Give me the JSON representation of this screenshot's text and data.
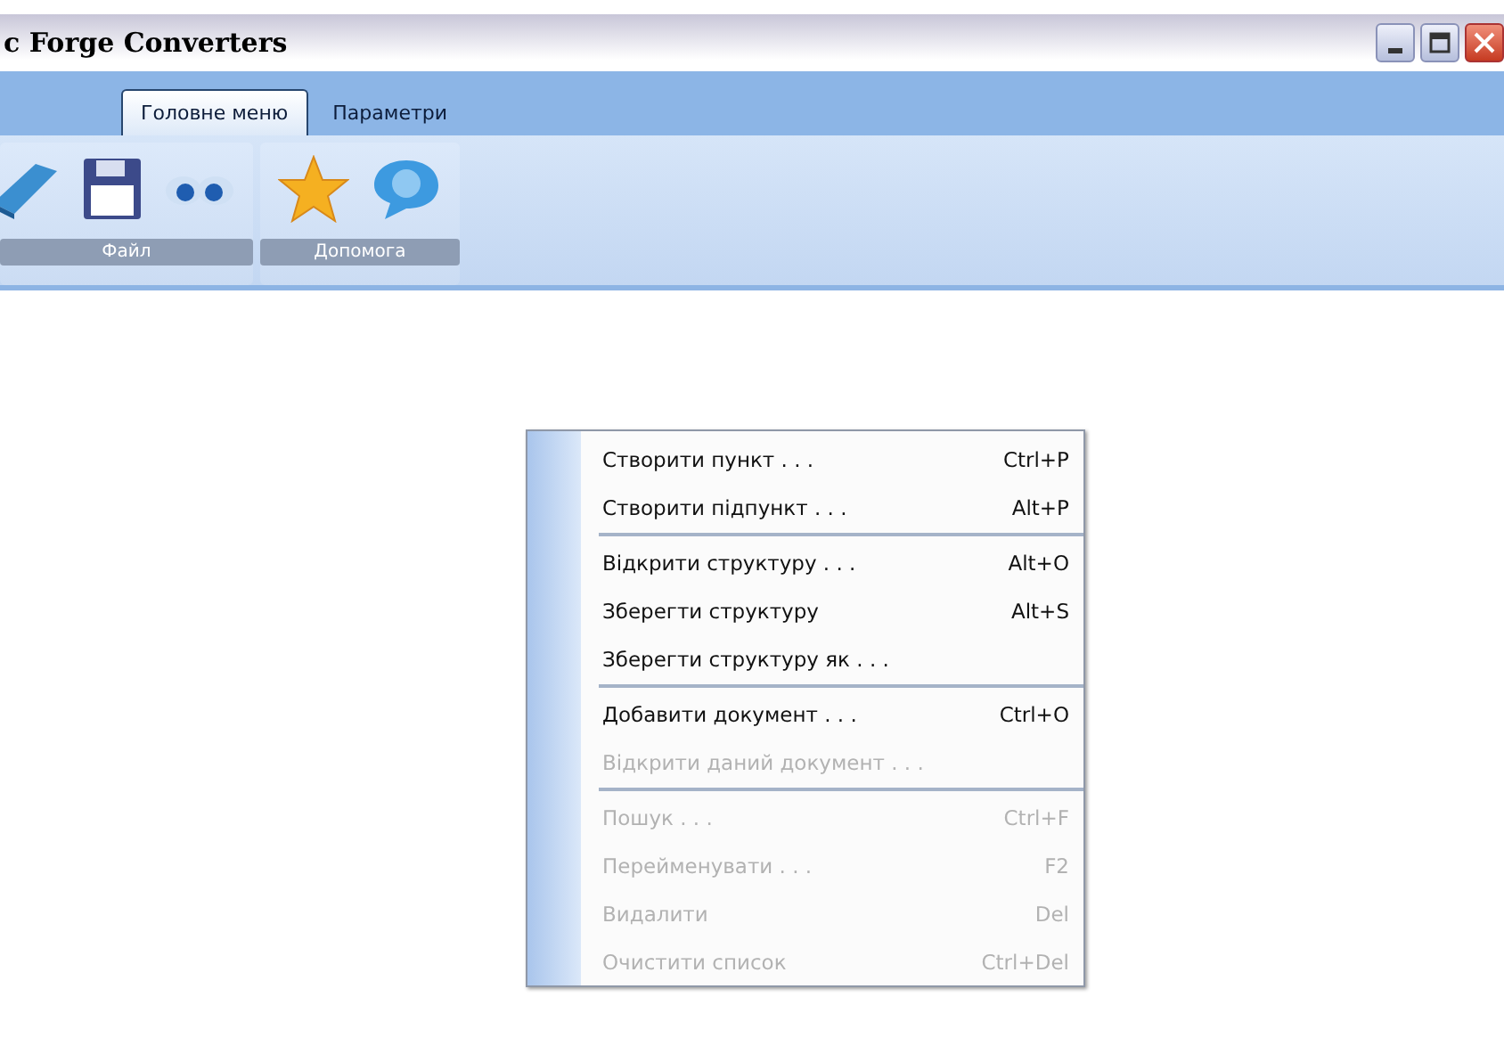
{
  "window": {
    "title": "c Forge Converters"
  },
  "tabs": [
    {
      "label": "Головне меню",
      "selected": true
    },
    {
      "label": "Параметри",
      "selected": false
    }
  ],
  "ribbon_groups": [
    {
      "label": "Файл",
      "icons": [
        {
          "kind": "book"
        },
        {
          "kind": "floppy"
        },
        {
          "kind": "binoculars"
        }
      ]
    },
    {
      "label": "Допомога",
      "icons": [
        {
          "kind": "star"
        },
        {
          "kind": "help"
        }
      ]
    }
  ],
  "menu": [
    {
      "kind": "item",
      "label": "Створити пункт . . .",
      "shortcut": "Ctrl+P",
      "disabled": false
    },
    {
      "kind": "item",
      "label": "Створити підпункт . . .",
      "shortcut": "Alt+P",
      "disabled": false
    },
    {
      "kind": "separator"
    },
    {
      "kind": "item",
      "label": "Відкрити структуру . . .",
      "shortcut": "Alt+O",
      "disabled": false
    },
    {
      "kind": "item",
      "label": "Зберегти структуру",
      "shortcut": "Alt+S",
      "disabled": false
    },
    {
      "kind": "item",
      "label": "Зберегти структуру як . . .",
      "disabled": false
    },
    {
      "kind": "separator"
    },
    {
      "kind": "item",
      "label": "Добавити документ . . .",
      "shortcut": "Ctrl+O",
      "disabled": false
    },
    {
      "kind": "item",
      "label": "Відкрити даний документ . . .",
      "disabled": true
    },
    {
      "kind": "separator"
    },
    {
      "kind": "item",
      "label": "Пошук . . .",
      "shortcut": "Ctrl+F",
      "disabled": true
    },
    {
      "kind": "item",
      "label": "Перейменувати . . .",
      "shortcut": "F2",
      "disabled": true
    },
    {
      "kind": "item",
      "label": "Видалити",
      "shortcut": "Del",
      "disabled": true
    },
    {
      "kind": "item",
      "label": "Очистити список",
      "shortcut": "Ctrl+Del",
      "disabled": true
    }
  ]
}
